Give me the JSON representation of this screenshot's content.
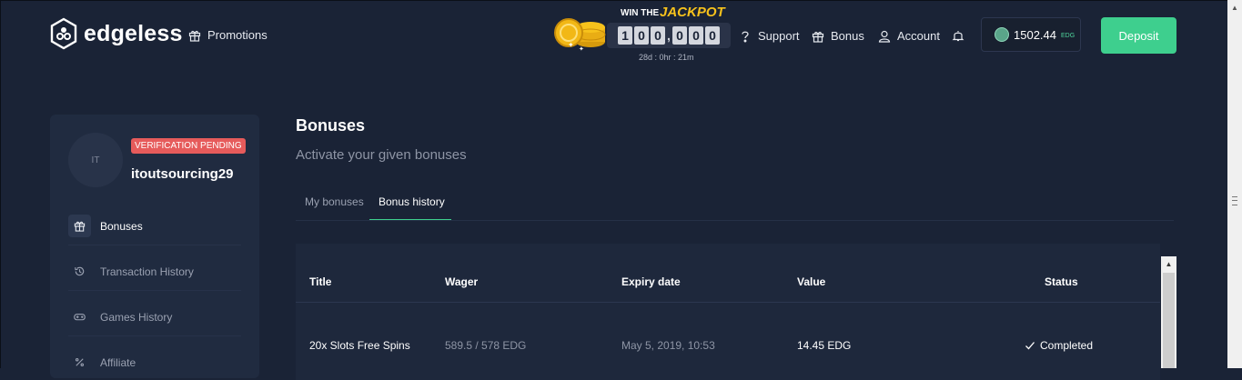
{
  "header": {
    "logo_text": "edgeless",
    "nav": {
      "promotions": "Promotions",
      "support": "Support",
      "bonus": "Bonus",
      "account": "Account"
    },
    "jackpot": {
      "win_the": "WIN THE",
      "jackpot_label": "JACKPOT",
      "digits": [
        "1",
        "0",
        "0",
        "0",
        "0",
        "0"
      ],
      "separator": ",",
      "timer": "28d : 0hr : 21m"
    },
    "balance": {
      "amount": "1502.44",
      "currency": "EDG"
    },
    "deposit_label": "Deposit"
  },
  "sidebar": {
    "avatar_initials": "IT",
    "verification_badge": "VERIFICATION PENDING",
    "username": "itoutsourcing29",
    "items": [
      {
        "label": "Bonuses",
        "icon": "gift-icon",
        "active": true
      },
      {
        "label": "Transaction History",
        "icon": "history-icon",
        "active": false
      },
      {
        "label": "Games History",
        "icon": "gamepad-icon",
        "active": false
      },
      {
        "label": "Affiliate",
        "icon": "percent-icon",
        "active": false
      }
    ]
  },
  "main": {
    "title": "Bonuses",
    "subtitle": "Activate your given bonuses",
    "tabs": [
      {
        "label": "My bonuses",
        "active": false
      },
      {
        "label": "Bonus history",
        "active": true
      }
    ],
    "table": {
      "columns": [
        "Title",
        "Wager",
        "Expiry date",
        "Value",
        "Status"
      ],
      "rows": [
        {
          "title": "20x Slots Free Spins",
          "wager": "589.5 / 578 EDG",
          "expiry": "May 5, 2019, 10:53",
          "value": "14.45 EDG",
          "status": "Completed"
        }
      ]
    }
  },
  "colors": {
    "background": "#1a2336",
    "panel": "#202b40",
    "accent_green": "#3ecf8e",
    "jackpot_gold": "#f7c21c",
    "badge_red": "#e65b5b"
  }
}
